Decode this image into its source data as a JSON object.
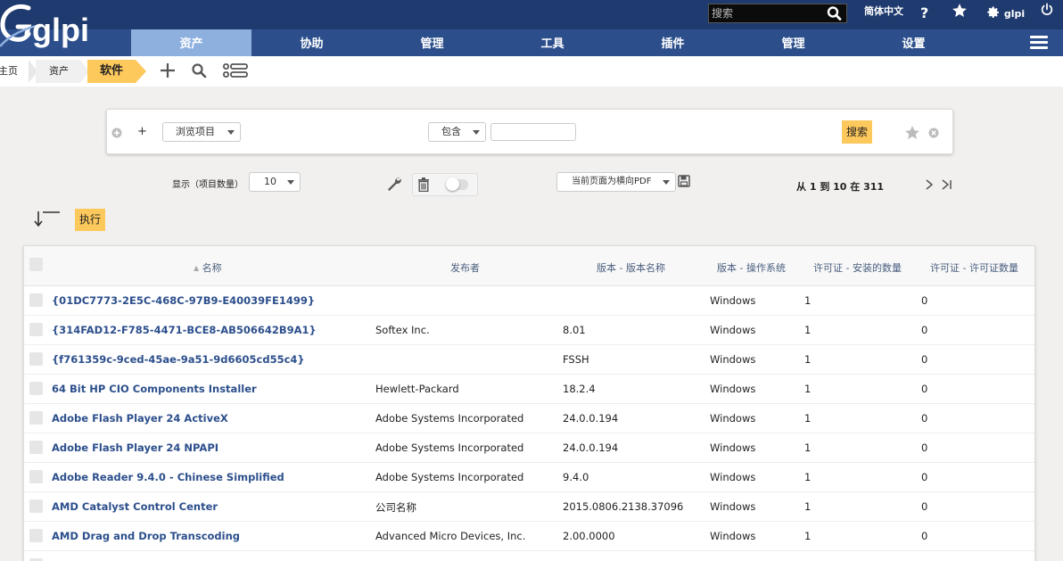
{
  "app": {
    "logo_text": "glpi",
    "search_placeholder": "搜索",
    "language": "简体中文",
    "user": "glpi"
  },
  "menu": [
    "资产",
    "协助",
    "管理",
    "工具",
    "插件",
    "管理",
    "设置"
  ],
  "breadcrumb": {
    "home": "主页",
    "assets": "资产",
    "current": "软件"
  },
  "criteria": {
    "field_select": "浏览项目",
    "operator_select": "包含",
    "value": "",
    "search_button": "搜索"
  },
  "controls": {
    "display_label": "显示（项目数量）",
    "display_count": "10",
    "export_select": "当前页面为横向PDF",
    "pager_text": "从 1 到 10 在 311",
    "execute_button": "执行"
  },
  "table": {
    "columns": [
      "名称",
      "发布者",
      "版本 - 版本名称",
      "版本 - 操作系统",
      "许可证 - 安装的数量",
      "许可证 - 许可证数量"
    ],
    "rows": [
      {
        "name": "{01DC7773-2E5C-468C-97B9-E40039FE1499}",
        "publisher": "",
        "version": "",
        "os": "Windows",
        "installs": "1",
        "licenses": "0"
      },
      {
        "name": "{314FAD12-F785-4471-BCE8-AB506642B9A1}",
        "publisher": "Softex Inc.",
        "version": "8.01",
        "os": "Windows",
        "installs": "1",
        "licenses": "0"
      },
      {
        "name": "{f761359c-9ced-45ae-9a51-9d6605cd55c4}",
        "publisher": "",
        "version": "FSSH",
        "os": "Windows",
        "installs": "1",
        "licenses": "0"
      },
      {
        "name": "64 Bit HP CIO Components Installer",
        "publisher": "Hewlett-Packard",
        "version": "18.2.4",
        "os": "Windows",
        "installs": "1",
        "licenses": "0"
      },
      {
        "name": "Adobe Flash Player 24 ActiveX",
        "publisher": "Adobe Systems Incorporated",
        "version": "24.0.0.194",
        "os": "Windows",
        "installs": "1",
        "licenses": "0"
      },
      {
        "name": "Adobe Flash Player 24 NPAPI",
        "publisher": "Adobe Systems Incorporated",
        "version": "24.0.0.194",
        "os": "Windows",
        "installs": "1",
        "licenses": "0"
      },
      {
        "name": "Adobe Reader 9.4.0 - Chinese Simplified",
        "publisher": "Adobe Systems Incorporated",
        "version": "9.4.0",
        "os": "Windows",
        "installs": "1",
        "licenses": "0"
      },
      {
        "name": "AMD Catalyst Control Center",
        "publisher": "公司名称",
        "version": "2015.0806.2138.37096",
        "os": "Windows",
        "installs": "1",
        "licenses": "0"
      },
      {
        "name": "AMD Drag and Drop Transcoding",
        "publisher": "Advanced Micro Devices, Inc.",
        "version": "2.00.0000",
        "os": "Windows",
        "installs": "1",
        "licenses": "0"
      }
    ]
  }
}
